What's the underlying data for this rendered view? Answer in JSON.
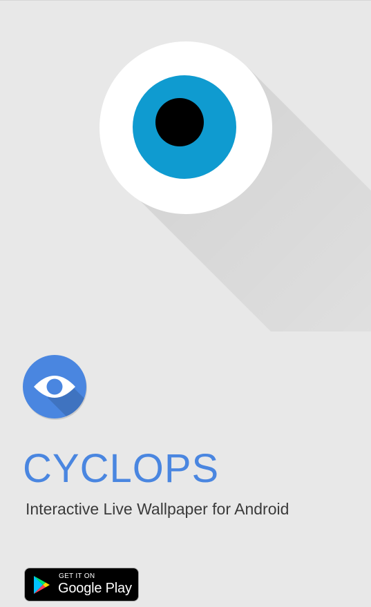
{
  "colors": {
    "background": "#e8e8e8",
    "accent": "#4a86e0",
    "iris": "#0f9bd0",
    "pupil": "#000000",
    "sclera": "#ffffff",
    "subtitle": "#3a3a3a"
  },
  "hero": {
    "icon": "eye-icon"
  },
  "app": {
    "icon": "eye-icon",
    "title": "CYCLOPS",
    "subtitle": "Interactive Live Wallpaper for Android"
  },
  "store_badge": {
    "icon": "google-play-icon",
    "small_text": "GET IT ON",
    "large_text": "Google Play"
  }
}
